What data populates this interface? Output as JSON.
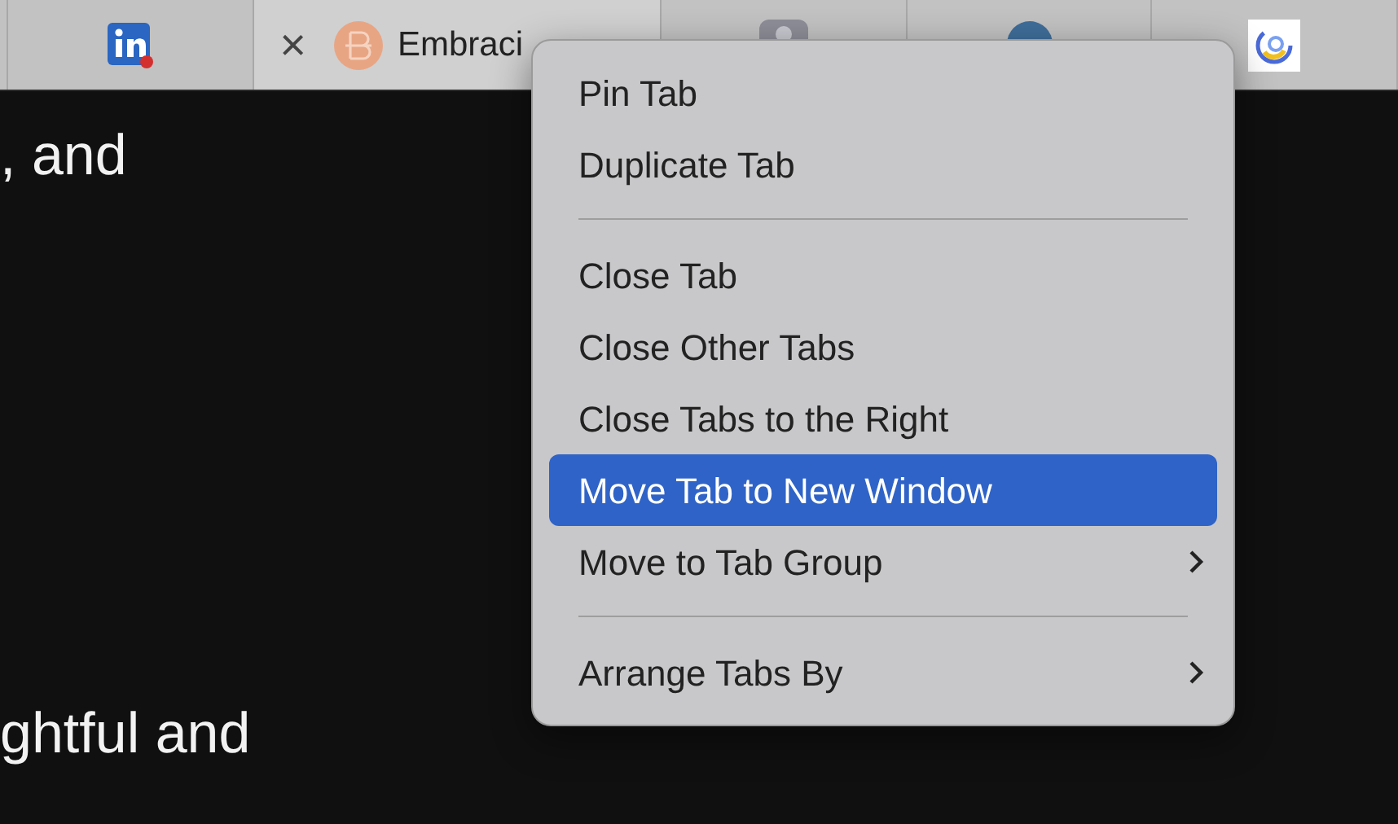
{
  "tabs": [
    {
      "kind": "edge",
      "selected": false
    },
    {
      "kind": "linkedin",
      "selected": false
    },
    {
      "kind": "page",
      "selected": true,
      "title": "Embraci",
      "close": "×"
    },
    {
      "kind": "grey",
      "selected": false
    },
    {
      "kind": "blue",
      "selected": false
    },
    {
      "kind": "swirl",
      "selected": false
    }
  ],
  "content": {
    "lines": [
      ", and",
      "ghtful and"
    ]
  },
  "context_menu": {
    "items": [
      {
        "kind": "item",
        "label": "Pin Tab",
        "selected": false
      },
      {
        "kind": "item",
        "label": "Duplicate Tab",
        "selected": false
      },
      {
        "kind": "separator"
      },
      {
        "kind": "item",
        "label": "Close Tab",
        "selected": false
      },
      {
        "kind": "item",
        "label": "Close Other Tabs",
        "selected": false
      },
      {
        "kind": "item",
        "label": "Close Tabs to the Right",
        "selected": false
      },
      {
        "kind": "item",
        "label": "Move Tab to New Window",
        "selected": true
      },
      {
        "kind": "submenu",
        "label": "Move to Tab Group",
        "selected": false
      },
      {
        "kind": "separator"
      },
      {
        "kind": "submenu",
        "label": "Arrange Tabs By",
        "selected": false
      }
    ]
  }
}
